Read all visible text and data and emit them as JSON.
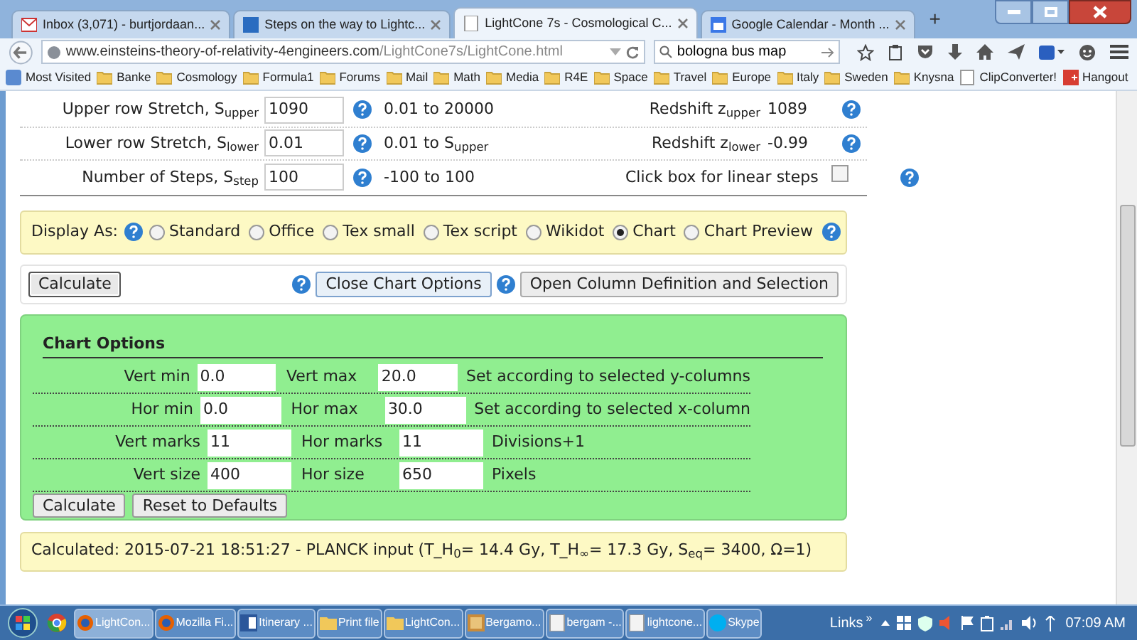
{
  "browser": {
    "tabs": [
      {
        "title": "Inbox (3,071) - burtjordaan...",
        "kind": "mail",
        "selected": false
      },
      {
        "title": "Steps on the way to Lightc...",
        "kind": "pf",
        "selected": false
      },
      {
        "title": "LightCone 7s - Cosmological C...",
        "kind": "page",
        "selected": true
      },
      {
        "title": "Google Calendar - Month ...",
        "kind": "calendar",
        "selected": false
      }
    ],
    "new_tab": "+",
    "url": {
      "domain": "www.einsteins-theory-of-relativity-4engineers.com",
      "path": "/LightCone7s/LightCone.html"
    },
    "search": {
      "value": "bologna bus map"
    },
    "bookmarks": [
      {
        "label": "Most Visited",
        "kind": "recent"
      },
      {
        "label": "Banke",
        "kind": "folder"
      },
      {
        "label": "Cosmology",
        "kind": "folder"
      },
      {
        "label": "Formula1",
        "kind": "folder"
      },
      {
        "label": "Forums",
        "kind": "folder"
      },
      {
        "label": "Mail",
        "kind": "folder"
      },
      {
        "label": "Math",
        "kind": "folder"
      },
      {
        "label": "Media",
        "kind": "folder"
      },
      {
        "label": "R4E",
        "kind": "folder"
      },
      {
        "label": "Space",
        "kind": "folder"
      },
      {
        "label": "Travel",
        "kind": "folder"
      },
      {
        "label": "Europe",
        "kind": "folder"
      },
      {
        "label": "Italy",
        "kind": "folder"
      },
      {
        "label": "Sweden",
        "kind": "folder"
      },
      {
        "label": "Knysna",
        "kind": "folder"
      },
      {
        "label": "ClipConverter!",
        "kind": "page"
      },
      {
        "label": "Hangout",
        "kind": "gplus"
      }
    ]
  },
  "parameters": [
    {
      "label": "Upper row Stretch, S$_{upper}$",
      "value": "1090",
      "range": "0.01 to 20000",
      "right_label": "Redshift z$_{upper}$",
      "kind": "readout",
      "right_value": "1089"
    },
    {
      "label": "Lower row Stretch, S$_{lower}$",
      "value": "0.01",
      "range": "0.01 to S$_{upper}$",
      "right_label": "Redshift z$_{lower}$",
      "kind": "readout",
      "right_value": "-0.99"
    },
    {
      "label": "Number of Steps, S$_{step}$",
      "value": "100",
      "range": "-100 to 100",
      "right_label": "Click box for linear steps",
      "kind": "checkbox",
      "checked": false
    }
  ],
  "display_as": {
    "label": "Display As:",
    "options": [
      {
        "label": "Standard",
        "selected": false
      },
      {
        "label": "Office",
        "selected": false
      },
      {
        "label": "Tex small",
        "selected": false
      },
      {
        "label": "Tex script",
        "selected": false
      },
      {
        "label": "Wikidot",
        "selected": false
      },
      {
        "label": "Chart",
        "selected": true
      },
      {
        "label": "Chart Preview",
        "selected": false
      }
    ]
  },
  "action_buttons": {
    "calculate": "Calculate",
    "close_chart_options": "Close Chart Options",
    "open_columns": "Open Column Definition and Selection"
  },
  "chart_options": {
    "title": "Chart Options",
    "rows": [
      {
        "label_1": "Vert min",
        "value_1": "0.0",
        "label_2": "Vert max",
        "value_2": "20.0",
        "note": "Set according to selected y-columns"
      },
      {
        "label_1": "Hor min",
        "value_1": "0.0",
        "label_2": "Hor max",
        "value_2": "30.0",
        "note": "Set according to selected x-column"
      },
      {
        "label_1": "Vert marks",
        "value_1": "11",
        "label_2": "Hor marks",
        "value_2": "11",
        "note": "Divisions+1"
      },
      {
        "label_1": "Vert size",
        "value_1": "400",
        "label_2": "Hor size",
        "value_2": "650",
        "note": "Pixels"
      }
    ],
    "buttons": [
      "Calculate",
      "Reset to Defaults"
    ]
  },
  "status": "Calculated: 2015-07-21 18:51:27 - PLANCK input (T_H$_{0}$= 14.4 Gy, T_H$_{∞}$= 17.3 Gy, S$_{eq}$= 3400, Ω=1)",
  "taskbar": {
    "items": [
      {
        "label": "LightCon...",
        "kind": "firefox",
        "selected": true
      },
      {
        "label": "Mozilla Fi...",
        "kind": "firefox",
        "selected": false
      },
      {
        "label": "Itinerary ...",
        "kind": "word",
        "selected": false
      },
      {
        "label": "Print file",
        "kind": "folder",
        "selected": false
      },
      {
        "label": "LightCon...",
        "kind": "folder",
        "selected": false
      },
      {
        "label": "Bergamo...",
        "kind": "image",
        "selected": false
      },
      {
        "label": "bergam -...",
        "kind": "page",
        "selected": false
      },
      {
        "label": "lightcone...",
        "kind": "page",
        "selected": false
      },
      {
        "label": "Skype",
        "kind": "skype",
        "selected": false
      }
    ],
    "links": "Links",
    "links_more": "»",
    "clock": "07:09 AM"
  }
}
